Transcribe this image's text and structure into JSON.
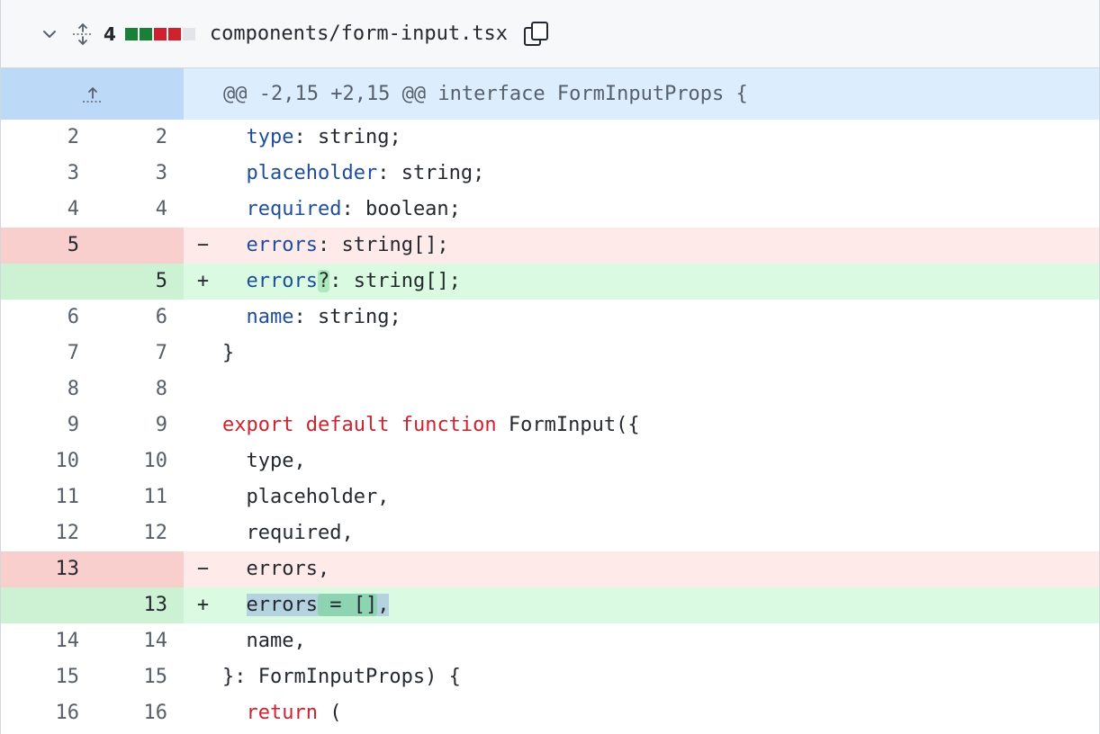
{
  "file": {
    "changes": "4",
    "path": "components/form-input.tsx",
    "diffstat_colors": [
      "#1a7f37",
      "#1a7f37",
      "#cf222e",
      "#cf222e",
      "#e1e4e8"
    ]
  },
  "hunk": {
    "header": "@@ -2,15 +2,15 @@ interface FormInputProps {"
  },
  "lines": {
    "l2": {
      "old": "2",
      "new": "2"
    },
    "l3": {
      "old": "3",
      "new": "3"
    },
    "l4": {
      "old": "4",
      "new": "4"
    },
    "l5d": {
      "old": "5",
      "marker": "−"
    },
    "l5a": {
      "new": "5",
      "marker": "+"
    },
    "l6": {
      "old": "6",
      "new": "6"
    },
    "l7": {
      "old": "7",
      "new": "7",
      "text": "}"
    },
    "l8": {
      "old": "8",
      "new": "8"
    },
    "l9": {
      "old": "9",
      "new": "9"
    },
    "l10": {
      "old": "10",
      "new": "10",
      "text": "  type,"
    },
    "l11": {
      "old": "11",
      "new": "11",
      "text": "  placeholder,"
    },
    "l12": {
      "old": "12",
      "new": "12",
      "text": "  required,"
    },
    "l13d": {
      "old": "13",
      "marker": "−",
      "text": "  errors,"
    },
    "l13a": {
      "new": "13",
      "marker": "+"
    },
    "l14": {
      "old": "14",
      "new": "14",
      "text": "  name,"
    },
    "l15": {
      "old": "15",
      "new": "15",
      "text": "}: FormInputProps) {"
    },
    "l16": {
      "old": "16",
      "new": "16"
    }
  },
  "tokens": {
    "type": "type",
    "type_rest": ": string;",
    "placeholder": "placeholder",
    "placeholder_rest": ": string;",
    "required": "required",
    "required_rest": ": boolean;",
    "errors": "errors",
    "errors_rest": ": string[];",
    "errors_opt": "?",
    "errors_opt_rest": ": string[];",
    "name": "name",
    "name_rest": ": string;",
    "export": "export",
    "default": "default",
    "function": "function",
    "fn_name": " FormInput({",
    "errors_sel": "errors",
    "errors_default": " = []",
    "errors_comma": ",",
    "return": "return",
    "return_rest": " ("
  }
}
